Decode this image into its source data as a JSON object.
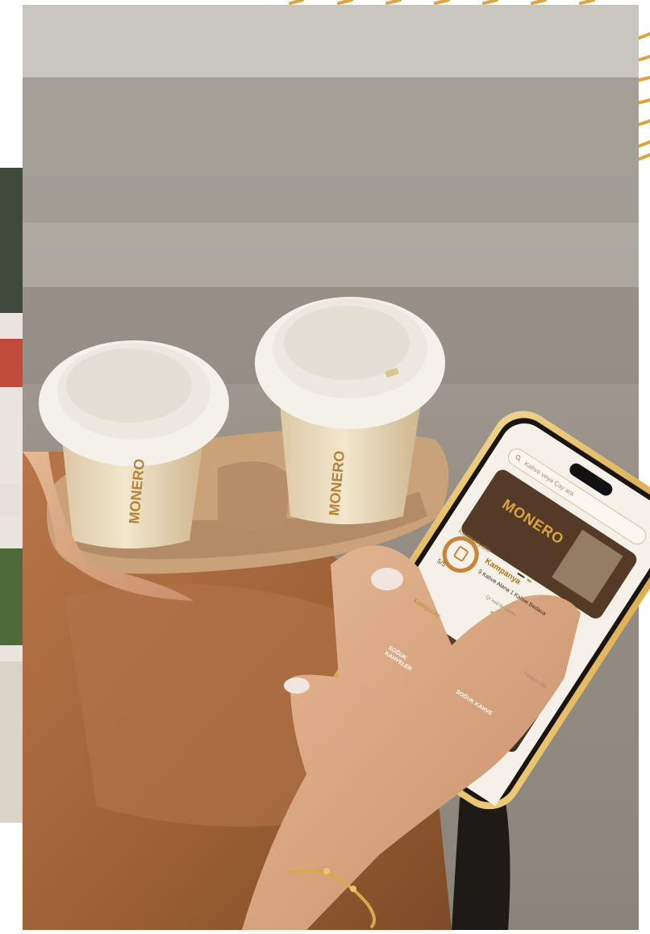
{
  "app": {
    "brand": "MONERO",
    "search": {
      "placeholder": "Kahve veya Çay ara"
    },
    "sections": {
      "campaigns": "Kampanyalar",
      "categories": "Kategoriler",
      "see_all": "Tümünü Gör"
    },
    "campaign": {
      "progress": "5/5",
      "title": "Kampanya",
      "description": "5 Kahve Alana 1 Kahve Bedava",
      "link": "Qr kod ile İzerim"
    },
    "categories": [
      {
        "label": "SOĞUK KAHVELER"
      },
      {
        "label": "SOĞUK KAHVE"
      }
    ],
    "cup_branding": "MONERO",
    "nav_icons": [
      "home-icon",
      "bag-icon"
    ]
  },
  "colors": {
    "gold_frame": "#e7b54a",
    "brand_gold": "#d9a441",
    "screen_bg": "#f6f1e8",
    "cup_color": "#efe2c7",
    "cup_lid": "#f7f4ee",
    "tray": "#c9a27a",
    "skirt": "#a86a3a"
  }
}
